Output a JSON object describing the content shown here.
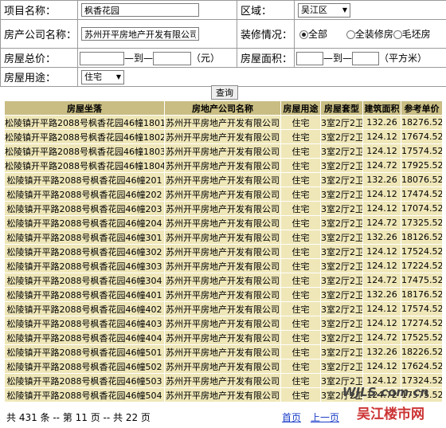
{
  "form": {
    "project_label": "项目名称：",
    "project_value": "枫香花园",
    "region_label": "区域：",
    "region_value": "吴江区",
    "company_label": "房产公司名称：",
    "company_value": "苏州开平房地产开发有限公司",
    "decor_label": "装修情况：",
    "decor_options": [
      "全部",
      "全装修房",
      "毛坯房"
    ],
    "price_label": "房屋总价：",
    "price_to": "—到—",
    "price_unit": "（元）",
    "area_label": "房屋面积：",
    "area_to": "—到—",
    "area_unit": "（平方米）",
    "usage_label": "房屋用途：",
    "usage_value": "住宅",
    "search_button": "查询"
  },
  "table": {
    "headers": [
      "房屋坐落",
      "房地产公司名称",
      "房屋用途",
      "房屋套型",
      "建筑面积",
      "参考单价"
    ],
    "rows": [
      [
        "松陵镇开平路2088号枫香花园46幢1801",
        "苏州开平房地产开发有限公司",
        "住宅",
        "3室2厅2卫",
        "132.26",
        "18276.52"
      ],
      [
        "松陵镇开平路2088号枫香花园46幢1802",
        "苏州开平房地产开发有限公司",
        "住宅",
        "3室2厅2卫",
        "124.12",
        "17674.52"
      ],
      [
        "松陵镇开平路2088号枫香花园46幢1803",
        "苏州开平房地产开发有限公司",
        "住宅",
        "3室2厅2卫",
        "124.12",
        "17574.52"
      ],
      [
        "松陵镇开平路2088号枫香花园46幢1804",
        "苏州开平房地产开发有限公司",
        "住宅",
        "3室2厅2卫",
        "124.72",
        "17925.52"
      ],
      [
        "松陵镇开平路2088号枫香花园46幢201",
        "苏州开平房地产开发有限公司",
        "住宅",
        "3室2厅2卫",
        "132.26",
        "18076.52"
      ],
      [
        "松陵镇开平路2088号枫香花园46幢202",
        "苏州开平房地产开发有限公司",
        "住宅",
        "3室2厅2卫",
        "124.12",
        "17474.52"
      ],
      [
        "松陵镇开平路2088号枫香花园46幢203",
        "苏州开平房地产开发有限公司",
        "住宅",
        "3室2厅2卫",
        "124.12",
        "17074.52"
      ],
      [
        "松陵镇开平路2088号枫香花园46幢204",
        "苏州开平房地产开发有限公司",
        "住宅",
        "3室2厅2卫",
        "124.72",
        "17325.52"
      ],
      [
        "松陵镇开平路2088号枫香花园46幢301",
        "苏州开平房地产开发有限公司",
        "住宅",
        "3室2厅2卫",
        "132.26",
        "18126.52"
      ],
      [
        "松陵镇开平路2088号枫香花园46幢302",
        "苏州开平房地产开发有限公司",
        "住宅",
        "3室2厅2卫",
        "124.12",
        "17524.52"
      ],
      [
        "松陵镇开平路2088号枫香花园46幢303",
        "苏州开平房地产开发有限公司",
        "住宅",
        "3室2厅2卫",
        "124.12",
        "17224.52"
      ],
      [
        "松陵镇开平路2088号枫香花园46幢304",
        "苏州开平房地产开发有限公司",
        "住宅",
        "3室2厅2卫",
        "124.72",
        "17475.52"
      ],
      [
        "松陵镇开平路2088号枫香花园46幢401",
        "苏州开平房地产开发有限公司",
        "住宅",
        "3室2厅2卫",
        "132.26",
        "18176.52"
      ],
      [
        "松陵镇开平路2088号枫香花园46幢402",
        "苏州开平房地产开发有限公司",
        "住宅",
        "3室2厅2卫",
        "124.12",
        "17574.52"
      ],
      [
        "松陵镇开平路2088号枫香花园46幢403",
        "苏州开平房地产开发有限公司",
        "住宅",
        "3室2厅2卫",
        "124.12",
        "17274.52"
      ],
      [
        "松陵镇开平路2088号枫香花园46幢404",
        "苏州开平房地产开发有限公司",
        "住宅",
        "3室2厅2卫",
        "124.72",
        "17525.52"
      ],
      [
        "松陵镇开平路2088号枫香花园46幢501",
        "苏州开平房地产开发有限公司",
        "住宅",
        "3室2厅2卫",
        "132.26",
        "18226.52"
      ],
      [
        "松陵镇开平路2088号枫香花园46幢502",
        "苏州开平房地产开发有限公司",
        "住宅",
        "3室2厅2卫",
        "124.12",
        "17624.52"
      ],
      [
        "松陵镇开平路2088号枫香花园46幢503",
        "苏州开平房地产开发有限公司",
        "住宅",
        "3室2厅2卫",
        "124.12",
        "17324.52"
      ],
      [
        "松陵镇开平路2088号枫香花园46幢504",
        "苏州开平房地产开发有限公司",
        "住宅",
        "3室2厅2卫",
        "124.72",
        "17575.52"
      ]
    ]
  },
  "pager": {
    "summary": "共 431 条 -- 第 11 页 -- 共 22 页",
    "first": "首页",
    "prev": "上一页"
  },
  "watermark": {
    "logo_text": "WJLS.com.cn",
    "site_text": "吴江楼市网"
  },
  "colors": {
    "header_bg": "#c9bd83",
    "row_bg": "#efe7b8",
    "link": "#1a3cc8"
  }
}
